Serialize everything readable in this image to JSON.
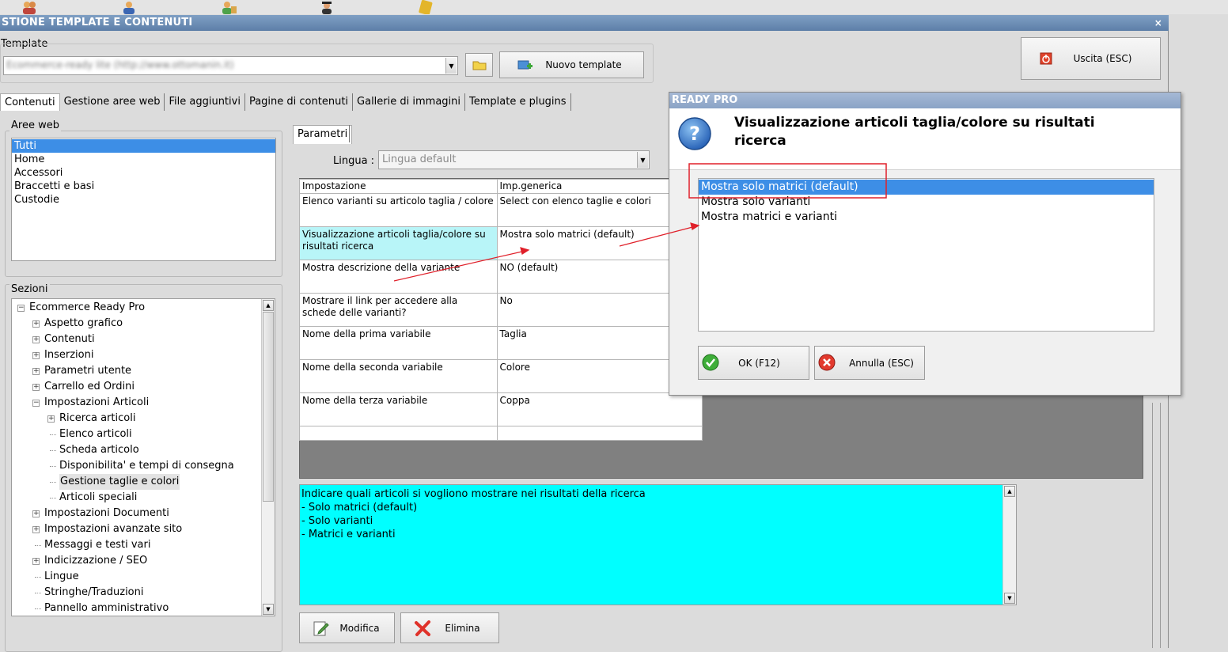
{
  "window": {
    "title": "STIONE TEMPLATE E CONTENUTI",
    "close_glyph": "×"
  },
  "template_bar": {
    "label": "Template",
    "selected_value": "Ecommerce-ready lite (http://www.ottomanin.it)",
    "new_template_label": "Nuovo template",
    "exit_label": "Uscita (ESC)"
  },
  "tabs": [
    {
      "label": "Contenuti",
      "active": true
    },
    {
      "label": "Gestione aree web"
    },
    {
      "label": "File aggiuntivi"
    },
    {
      "label": "Pagine di contenuti"
    },
    {
      "label": "Gallerie di immagini"
    },
    {
      "label": "Template e plugins"
    }
  ],
  "aree_web": {
    "title": "Aree web",
    "items": [
      "Tutti",
      "Home",
      "Accessori",
      "Braccetti e basi",
      "Custodie"
    ],
    "selected_index": 0
  },
  "sezioni": {
    "title": "Sezioni",
    "items": [
      {
        "label": "Ecommerce Ready Pro",
        "level": 0,
        "expander": "−"
      },
      {
        "label": "Aspetto grafico",
        "level": 1,
        "expander": "+"
      },
      {
        "label": "Contenuti",
        "level": 1,
        "expander": "+"
      },
      {
        "label": "Inserzioni",
        "level": 1,
        "expander": "+"
      },
      {
        "label": "Parametri utente",
        "level": 1,
        "expander": "+"
      },
      {
        "label": "Carrello ed Ordini",
        "level": 1,
        "expander": "+"
      },
      {
        "label": "Impostazioni Articoli",
        "level": 1,
        "expander": "−"
      },
      {
        "label": "Ricerca articoli",
        "level": 2,
        "expander": "+"
      },
      {
        "label": "Elenco articoli",
        "level": 2,
        "expander": ""
      },
      {
        "label": "Scheda articolo",
        "level": 2,
        "expander": ""
      },
      {
        "label": "Disponibilita' e tempi di consegna",
        "level": 2,
        "expander": ""
      },
      {
        "label": "Gestione taglie e colori",
        "level": 2,
        "expander": "",
        "selected": true
      },
      {
        "label": "Articoli speciali",
        "level": 2,
        "expander": ""
      },
      {
        "label": "Impostazioni Documenti",
        "level": 1,
        "expander": "+"
      },
      {
        "label": "Impostazioni avanzate sito",
        "level": 1,
        "expander": "+"
      },
      {
        "label": "Messaggi e testi vari",
        "level": 1,
        "expander": ""
      },
      {
        "label": "Indicizzazione / SEO",
        "level": 1,
        "expander": "+"
      },
      {
        "label": "Lingue",
        "level": 1,
        "expander": ""
      },
      {
        "label": "Stringhe/Traduzioni",
        "level": 1,
        "expander": ""
      },
      {
        "label": "Pannello amministrativo",
        "level": 1,
        "expander": ""
      }
    ]
  },
  "parametri": {
    "tab_label": "Parametri",
    "lingua_label": "Lingua :",
    "lingua_value": "Lingua default",
    "columns": [
      "Impostazione",
      "Imp.generica"
    ],
    "rows": [
      {
        "setting": "Elenco varianti su articolo taglia / colore",
        "value": "Select con elenco taglie e colori"
      },
      {
        "setting": "Visualizzazione articoli taglia/colore su risultati ricerca",
        "value": "Mostra solo matrici (default)",
        "highlight": true
      },
      {
        "setting": "Mostra descrizione della variante",
        "value": "NO (default)"
      },
      {
        "setting": "Mostrare il link per accedere alla schede delle varianti?",
        "value": "No"
      },
      {
        "setting": "Nome della prima variabile",
        "value": "Taglia"
      },
      {
        "setting": "Nome della seconda variabile",
        "value": "Colore"
      },
      {
        "setting": "Nome della terza variabile",
        "value": "Coppa"
      },
      {
        "setting": "",
        "value": ""
      }
    ],
    "description": [
      "Indicare quali articoli si vogliono mostrare nei risultati della ricerca",
      "- Solo matrici (default)",
      "- Solo varianti",
      "- Matrici e varianti"
    ],
    "modifica_label": "Modifica",
    "elimina_label": "Elimina"
  },
  "dialog": {
    "title": "READY PRO",
    "question": "Visualizzazione articoli taglia/colore su risultati ricerca",
    "options": [
      "Mostra solo matrici (default)",
      "Mostra solo varianti",
      "Mostra matrici e varianti"
    ],
    "selected_index": 0,
    "ok_label": "OK (F12)",
    "cancel_label": "Annulla (ESC)"
  },
  "colors": {
    "title_bar": "#5d7fa8",
    "selection": "#3d8ee6",
    "highlight_row": "#b8f5f8",
    "description_bg": "#00ffff",
    "annotation_red": "#e0202a"
  }
}
